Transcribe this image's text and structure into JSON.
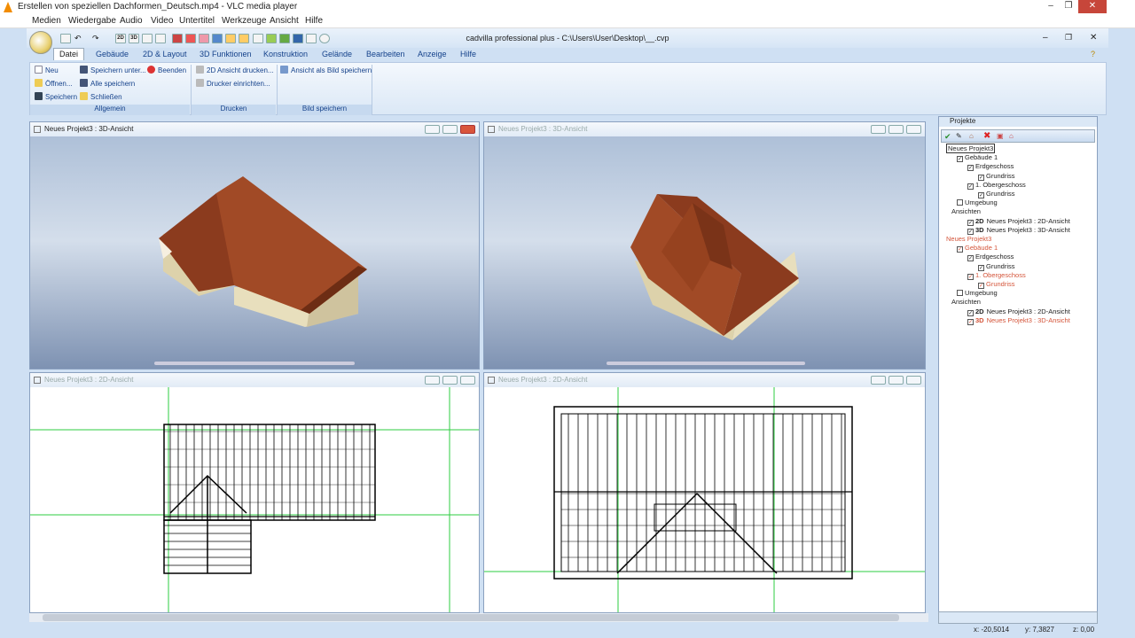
{
  "vlc": {
    "title": "Erstellen von speziellen Dachformen_Deutsch.mp4 - VLC media player",
    "menu": [
      "Medien",
      "Wiedergabe",
      "Audio",
      "Video",
      "Untertitel",
      "Werkzeuge",
      "Ansicht",
      "Hilfe"
    ]
  },
  "app": {
    "title": "cadvilla professional plus - C:\\Users\\User\\Desktop\\__.cvp",
    "tabs": [
      "Datei",
      "Gebäude",
      "2D & Layout",
      "3D Funktionen",
      "Konstruktion",
      "Gelände",
      "Bearbeiten",
      "Anzeige",
      "Hilfe"
    ],
    "active_tab": "Datei",
    "qat_labels": [
      "2D",
      "3D"
    ],
    "ribbon": {
      "allgemein": {
        "label": "Allgemein",
        "items": [
          "Neu",
          "Speichern unter...",
          "Beenden",
          "Öffnen...",
          "Alle speichern",
          "Speichern",
          "Schließen"
        ]
      },
      "drucken": {
        "label": "Drucken",
        "items": [
          "2D Ansicht drucken...",
          "Drucker einrichten..."
        ]
      },
      "bild": {
        "label": "Bild speichern",
        "items": [
          "Ansicht als Bild speichern"
        ]
      }
    }
  },
  "panes": {
    "p3d_left": "Neues Projekt3 : 3D-Ansicht",
    "p3d_right": "Neues Projekt3 : 3D-Ansicht",
    "p2d_left": "Neues Projekt3 : 2D-Ansicht",
    "p2d_right": "Neues Projekt3 : 2D-Ansicht"
  },
  "projects": {
    "title": "Projekte",
    "tree": [
      {
        "label": "Neues Projekt3",
        "level": 0,
        "cb": false,
        "red": false,
        "boxed": true
      },
      {
        "label": "Gebäude 1",
        "level": 1,
        "cb": true,
        "red": false
      },
      {
        "label": "Erdgeschoss",
        "level": 2,
        "cb": true,
        "red": false
      },
      {
        "label": "Grundriss",
        "level": 3,
        "cb": true,
        "red": false
      },
      {
        "label": "1. Obergeschoss",
        "level": 2,
        "cb": true,
        "red": false
      },
      {
        "label": "Grundriss",
        "level": 3,
        "cb": true,
        "red": false
      },
      {
        "label": "Umgebung",
        "level": 1,
        "cb": "empty",
        "red": false
      },
      {
        "label": "Ansichten",
        "level": 0.5,
        "cb": false,
        "red": false
      },
      {
        "label": "Neues Projekt3 : 2D-Ansicht",
        "level": 2,
        "cb": true,
        "red": false,
        "tag": "2D"
      },
      {
        "label": "Neues Projekt3 : 3D-Ansicht",
        "level": 2,
        "cb": true,
        "red": false,
        "tag": "3D"
      },
      {
        "label": "Neues Projekt3",
        "level": 0,
        "cb": false,
        "red": true
      },
      {
        "label": "Gebäude 1",
        "level": 1,
        "cb": true,
        "red": true
      },
      {
        "label": "Erdgeschoss",
        "level": 2,
        "cb": true,
        "red": false
      },
      {
        "label": "Grundriss",
        "level": 3,
        "cb": true,
        "red": false
      },
      {
        "label": "1. Obergeschoss",
        "level": 2,
        "cb": true,
        "red": true
      },
      {
        "label": "Grundriss",
        "level": 3,
        "cb": true,
        "red": true
      },
      {
        "label": "Umgebung",
        "level": 1,
        "cb": "empty",
        "red": false
      },
      {
        "label": "Ansichten",
        "level": 0.5,
        "cb": false,
        "red": false
      },
      {
        "label": "Neues Projekt3 : 2D-Ansicht",
        "level": 2,
        "cb": true,
        "red": false,
        "tag": "2D"
      },
      {
        "label": "Neues Projekt3 : 3D-Ansicht",
        "level": 2,
        "cb": true,
        "red": true,
        "tag": "3D"
      }
    ]
  },
  "status": {
    "x": "x: -20,5014",
    "y": "y: 7,3827",
    "z": "z: 0,00"
  },
  "colors": {
    "roof": "#8a3a1f",
    "wall": "#e6dcb8",
    "grid_green": "#2ecc40",
    "highlight_red": "#d4553a"
  }
}
